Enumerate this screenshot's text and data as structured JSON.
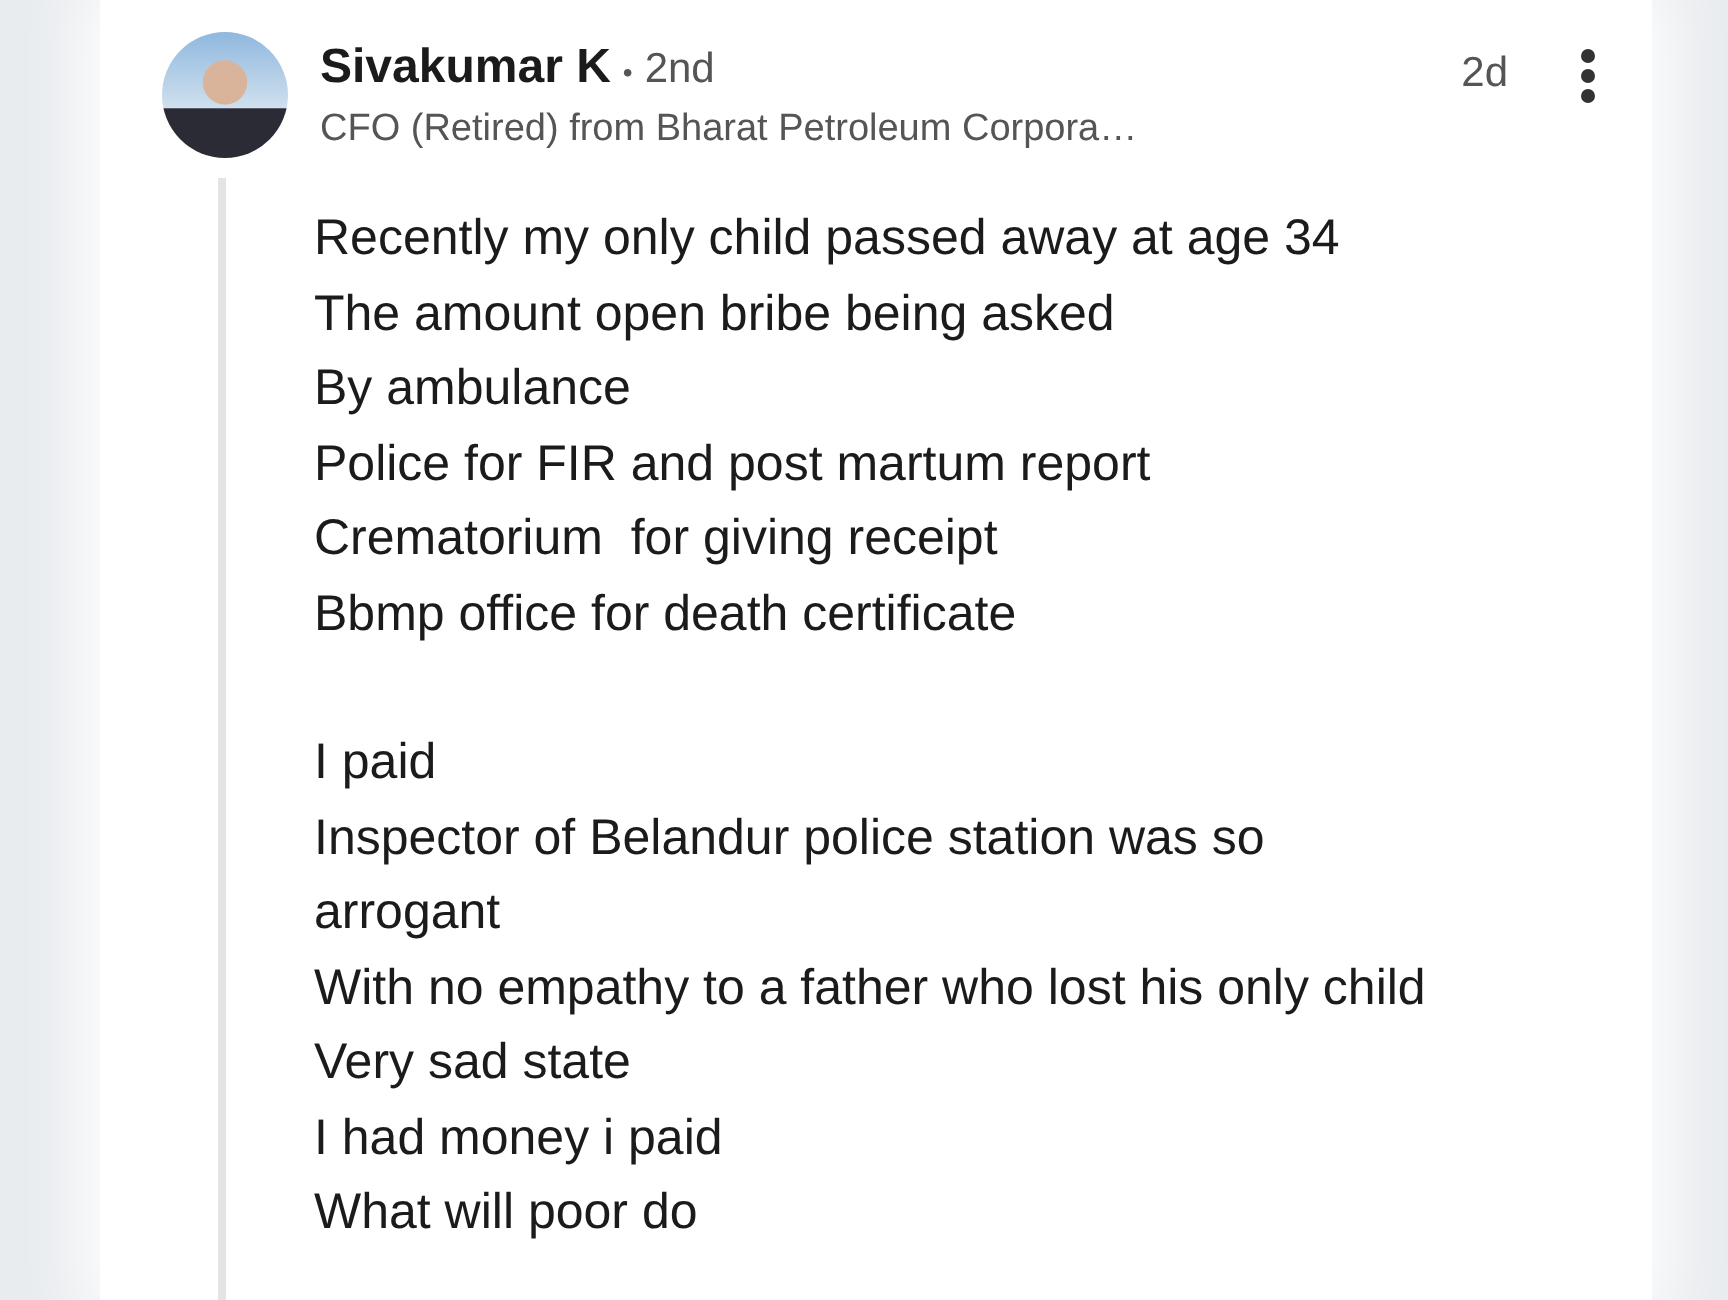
{
  "comment": {
    "author": {
      "name": "Sivakumar K",
      "separator": "•",
      "degree": "2nd",
      "headline": "CFO (Retired) from Bharat Petroleum Corpora…"
    },
    "time": "2d",
    "paragraphs": [
      [
        "Recently my only child passed away at age 34",
        "The amount open bribe being asked",
        "By ambulance",
        "Police for FIR and post martum report",
        "Crematorium  for giving receipt",
        "Bbmp office for death certificate"
      ],
      [
        "I paid",
        "Inspector of Belandur police station was so",
        "arrogant",
        "With no empathy to a father who lost his only child",
        "Very sad state",
        "I had money i paid",
        "What will poor do"
      ]
    ]
  }
}
